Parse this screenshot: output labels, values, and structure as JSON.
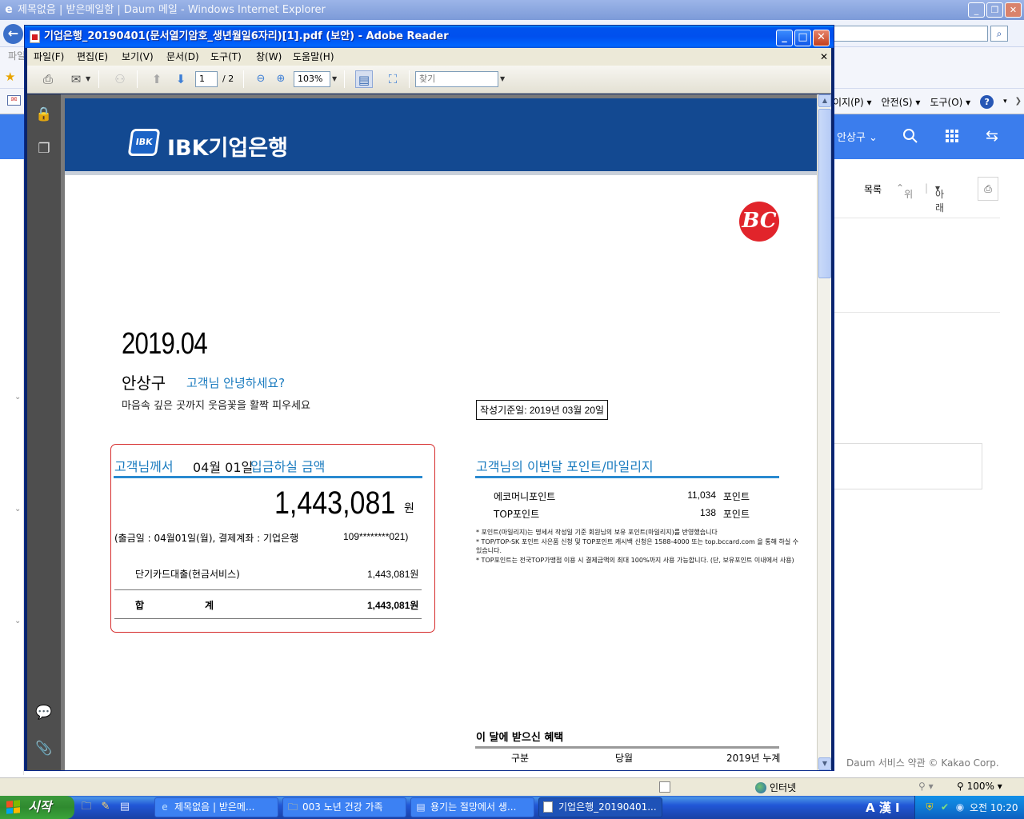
{
  "ie": {
    "title": "제목없음 | 받은메일함 | Daum 메일 - Windows Internet Explorer",
    "menu_partial": "파일",
    "cmd_items": [
      {
        "label": "이지(P)"
      },
      {
        "label": "안전(S)"
      },
      {
        "label": "도구(O)"
      }
    ],
    "daum": {
      "user_label": "안상구 ⌄",
      "toolbar": {
        "list": "목록",
        "up": "위",
        "down": "아래"
      },
      "footer": "Daum 서비스 약관  © Kakao Corp."
    },
    "status": {
      "zone": "인터넷",
      "zoom": "100%"
    }
  },
  "reader": {
    "title": "기업은행_20190401(문서열기암호_생년월일6자리)[1].pdf (보안) - Adobe Reader",
    "menus": [
      "파일(F)",
      "편집(E)",
      "보기(V)",
      "문서(D)",
      "도구(T)",
      "창(W)",
      "도움말(H)"
    ],
    "page_current": "1",
    "page_total": "/ 2",
    "zoom": "103%",
    "find_placeholder": "찾기"
  },
  "statement": {
    "bank_logo": "IBK기업은행",
    "card_brand": "BC",
    "month": "2019.04",
    "customer_name": "안상구",
    "greeting": "고객님 안녕하세요?",
    "greeting_sub": "마음속 깊은 곳까지 웃음꽃을 활짝 피우세요",
    "base_date": "작성기준일: 2019년 03월 20일",
    "deposit": {
      "title_a": "고객님께서",
      "date": "04월 01일",
      "title_b": "입금하실 금액",
      "amount": "1,443,081",
      "unit": "원",
      "info": "(출금일 : 04월01일(월), 결제계좌 : 기업은행",
      "account": "109********021)",
      "item_label": "단기카드대출(현금서비스)",
      "item_value": "1,443,081원",
      "total_a": "합",
      "total_b": "계",
      "total_value": "1,443,081원"
    },
    "points": {
      "title": "고객님의 이번달 포인트/마일리지",
      "rows": [
        {
          "name": "에코머니포인트",
          "value": "11,034",
          "unit": "포인트"
        },
        {
          "name": "TOP포인트",
          "value": "138",
          "unit": "포인트"
        }
      ],
      "notes": [
        "* 포인트(마일리지)는 명세서 작성일 기준 회원님의 보유 포인트(마일리지)를 반영했습니다",
        "* TOP/TOP-SK 포인트 사은품 신청 및 TOP포인트 캐시백 신청은 1588-4000 또는 top.bccard.com 을 통해 하실 수 있습니다.",
        "* TOP포인트는 전국TOP가맹점 이용 시 결제금액의 최대 100%까지 사용 가능합니다. (단, 보유포인트 이내에서 사용)"
      ]
    },
    "benefits": {
      "title": "이 달에 받으신 혜택",
      "headers": [
        "구분",
        "당월",
        "2019년 누계"
      ]
    }
  },
  "taskbar": {
    "start": "시작",
    "tasks": [
      {
        "label": "제목없음 | 받은메..."
      },
      {
        "label": "003 노년 건강 가족"
      },
      {
        "label": "용기는 절망에서 생..."
      },
      {
        "label": "기업은행_20190401..."
      }
    ],
    "lang": "A 漢 I",
    "clock": "오전 10:20"
  }
}
